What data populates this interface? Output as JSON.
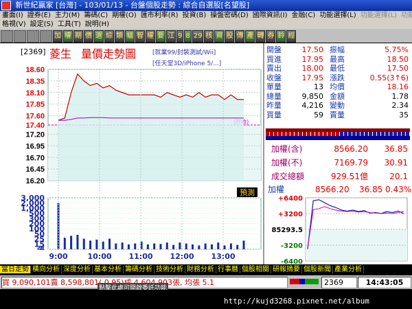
{
  "window": {
    "title": "新世紀贏家 [台灣] - 103/01/13 - 台盤個股走勢 : 綜合自選股[名望股]"
  },
  "menu": {
    "row1": [
      "畫面(I)",
      "證券(E)",
      "主力(M)",
      "籌碼(C)",
      "期權(O)",
      "匯市利率(R)",
      "投資(B)",
      "操盤密碼(D)",
      "國際資訊(I)",
      "金融(C)",
      "功能選擇(L)",
      "功能選擇(L)",
      "功能選擇(L)"
    ],
    "row2": [
      "格視(V)",
      "設定(S)",
      "工具(T)",
      "說明(H)"
    ]
  },
  "toolbar": {
    "buttons": [
      "加",
      "權",
      "期",
      "價",
      "選",
      "綜",
      "類",
      "幅",
      "智",
      "權",
      "要",
      "江",
      "9",
      "8",
      "29",
      "核",
      "資",
      "股",
      "傳",
      "產",
      "轉",
      "券",
      "鈴",
      "經"
    ]
  },
  "chart": {
    "code": "[2369]",
    "stock_name": "菱生",
    "title": "量價走勢圖",
    "news1": "[就業99/封裝測試/Wii]",
    "news2": "[任天堂3D/iPhone 5/...]",
    "price_ticks": [
      "18.60",
      "18.35",
      "18.10",
      "17.85",
      "17.60",
      "17.40",
      "17.20",
      "16.95",
      "16.70",
      "16.45",
      "16.20"
    ],
    "volume_ticks": [
      "3,000",
      "2,000",
      "1,000",
      "500",
      "300",
      "200",
      "100",
      "50",
      "25",
      "15",
      "張"
    ],
    "time_ticks": [
      "9:00",
      "10:00",
      "11:00",
      "12:00",
      "13:00"
    ],
    "ref_label": "(昨收)",
    "forecast_label": "預測"
  },
  "chart_data": {
    "type": "line",
    "title": "量價走勢圖",
    "x_range": [
      "9:00",
      "13:30"
    ],
    "ylim": [
      16.2,
      18.6
    ],
    "reference_close": 17.4,
    "series": [
      {
        "values": [
          17.5,
          17.55,
          18.1,
          18.5,
          18.35,
          18.25,
          18.3,
          18.2,
          18.25,
          18.15,
          18.1,
          18.05,
          18.05,
          18.05,
          18.05,
          18.05,
          18.0,
          18.1,
          18.05,
          18.0,
          18.05,
          18.0,
          18.1,
          18.0,
          18.05,
          18.05,
          17.95,
          18.05,
          17.95,
          17.95
        ]
      },
      {
        "values": [
          17.5,
          17.5,
          17.52,
          17.55,
          17.55,
          17.56,
          17.56,
          17.56,
          17.55,
          17.55,
          17.55,
          17.55,
          17.55,
          17.55,
          17.55,
          17.55,
          17.55,
          17.55,
          17.55,
          17.55,
          17.55,
          17.55,
          17.55,
          17.55,
          17.55,
          17.55,
          17.55,
          17.55,
          17.55,
          17.55
        ]
      }
    ],
    "volume": [
      480,
      120,
      140,
      150,
      110,
      90,
      100,
      80,
      110,
      60,
      70,
      50,
      60,
      80,
      50,
      60,
      55,
      70,
      45,
      70,
      60,
      50,
      40,
      60,
      50,
      70,
      40,
      60,
      45,
      90
    ]
  },
  "quote": {
    "rows": [
      {
        "l1": "開盤",
        "v1": "17.50",
        "l2": "振幅",
        "v2": "5.75%"
      },
      {
        "l1": "買進",
        "v1": "17.95",
        "l2": "最高",
        "v2": "18.50"
      },
      {
        "l1": "賣出",
        "v1": "18.00",
        "l2": "最低",
        "v2": "17.50"
      },
      {
        "l1": "收盤",
        "v1": "17.95",
        "l2": "漲跌",
        "v2": "0.55(3↑6)"
      },
      {
        "l1": "單量",
        "v1": "13",
        "l2": "均價",
        "v2": "18.16"
      },
      {
        "l1": "總量",
        "v1": "9,850",
        "l2": "金額",
        "v2": "1.78"
      },
      {
        "l1": "昨量",
        "v1": "4,216",
        "l2": "變動",
        "v2": "2.34"
      },
      {
        "l1": "買量",
        "v1": "59",
        "l2": "賣量",
        "v2": "35"
      }
    ]
  },
  "index": {
    "rows": [
      {
        "label": "加權(含)",
        "value": "8566.20",
        "change": "36.85"
      },
      {
        "label": "加權(不)",
        "value": "7169.79",
        "change": "30.91"
      },
      {
        "label": "成交總額",
        "value": "929.51億",
        "change": "20.1"
      }
    ],
    "mini_label": "加權",
    "mini_value": "8566.20",
    "mini_change": "36.85",
    "mini_pct": "0.43%",
    "mini_ticks": [
      "+6400",
      "+3200",
      "85293.5",
      "-3200",
      "-6400"
    ]
  },
  "mini_chart_data": {
    "type": "line",
    "x_range": [
      "9:00",
      "13:30"
    ],
    "series": [
      {
        "values": [
          -4000,
          5800,
          6000,
          5400,
          4800,
          4400,
          3900,
          3700,
          3900,
          3600,
          3800,
          3300,
          3400,
          3200,
          3600,
          3400,
          3700,
          3200
        ]
      },
      {
        "values": [
          -3800,
          4000,
          4200,
          4600,
          4200,
          3900,
          3700,
          3600,
          3700,
          3500,
          3600,
          3400,
          3300,
          3200,
          3300,
          3200,
          3400,
          3600
        ]
      }
    ]
  },
  "status": {
    "tabs": [
      "當日走勢",
      "橫向分析",
      "深度分析",
      "基本分析",
      "籌碼分析",
      "技術分析",
      "財務分析",
      "行事曆",
      "個股相關",
      "研報摘要",
      "個股新聞",
      "產業分析"
    ]
  },
  "bottom": {
    "ticker": "買 9,090,101賣 8,598,801( 0.95)成 4,604,903張, 均張 5.1",
    "code": "2369",
    "clock": "14:43:05",
    "hint": "點擊此處可開啟委託功能"
  },
  "watermark": "http://kujd3268.pixnet.net/album",
  "colors": {
    "price_line": "#c00000",
    "avg_line": "#a000c0",
    "ref_line": "#c000c0",
    "volume": "#1a2aa0",
    "fill": "#d6f0ee",
    "up": "#e00000"
  }
}
